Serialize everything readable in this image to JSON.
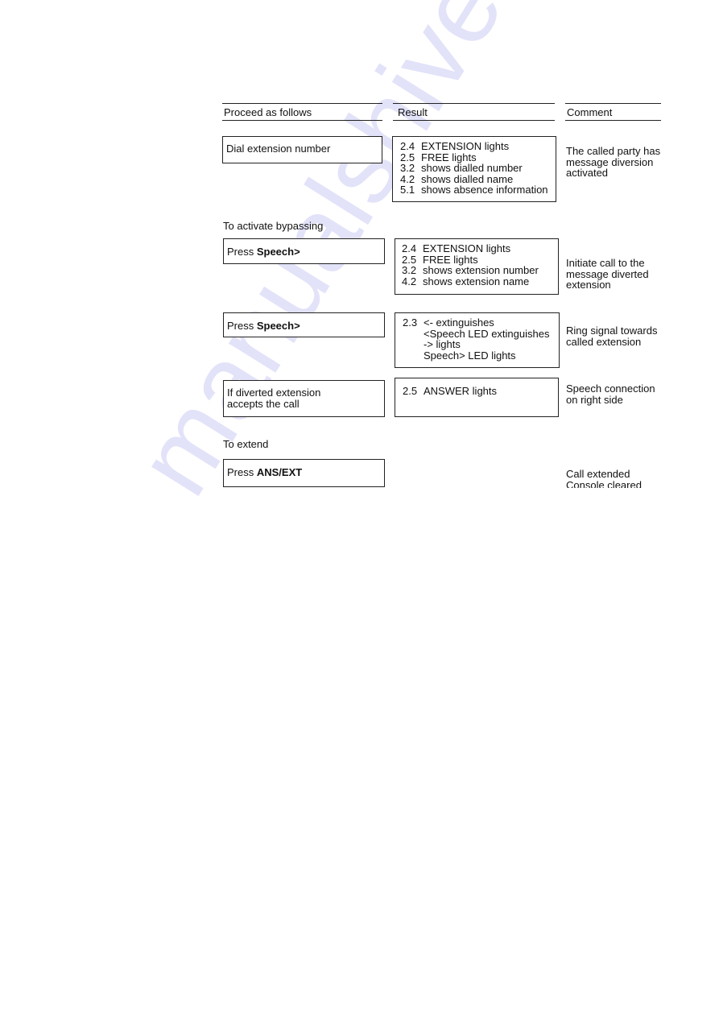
{
  "headers": {
    "proceed": "Proceed as follows",
    "result": "Result",
    "comment": "Comment"
  },
  "steps": [
    {
      "action": "Dial extension number",
      "results": [
        {
          "num": "2.4",
          "text": "EXTENSION lights"
        },
        {
          "num": "2.5",
          "text": "FREE lights"
        },
        {
          "num": "3.2",
          "text": "shows dialled number"
        },
        {
          "num": "4.2",
          "text": "shows dialled name"
        },
        {
          "num": "5.1",
          "text": "shows absence information"
        }
      ],
      "comment": [
        "The called party has",
        "message diversion",
        "activated"
      ]
    }
  ],
  "section_bypass": "To activate bypassing",
  "bypass_steps": [
    {
      "action_prefix": "Press ",
      "action_bold": "Speech>",
      "results": [
        {
          "num": "2.4",
          "text": "EXTENSION lights"
        },
        {
          "num": "2.5",
          "text": "FREE lights"
        },
        {
          "num": "3.2",
          "text": "shows extension number"
        },
        {
          "num": "4.2",
          "text": "shows extension name"
        }
      ],
      "comment": [
        "Initiate call to the",
        "message diverted",
        "extension"
      ]
    },
    {
      "action_prefix": "Press ",
      "action_bold": "Speech>",
      "results": [
        {
          "num": "2.3",
          "text": "<- extinguishes"
        },
        {
          "num": "",
          "text": "<Speech LED extinguishes"
        },
        {
          "num": "",
          "text": "-> lights"
        },
        {
          "num": "",
          "text": "Speech> LED lights"
        }
      ],
      "comment": [
        "Ring signal towards",
        "called extension"
      ]
    },
    {
      "action_lines": [
        "If diverted extension",
        "accepts the call"
      ],
      "results": [
        {
          "num": "2.5",
          "text": "ANSWER lights"
        }
      ],
      "comment": [
        "Speech connection",
        "on right side"
      ]
    }
  ],
  "section_extend": "To extend",
  "extend_step": {
    "action_prefix": "Press ",
    "action_bold": "ANS/EXT",
    "comment": [
      "Call extended",
      "Console cleared"
    ]
  },
  "watermark": "manualshive.com"
}
